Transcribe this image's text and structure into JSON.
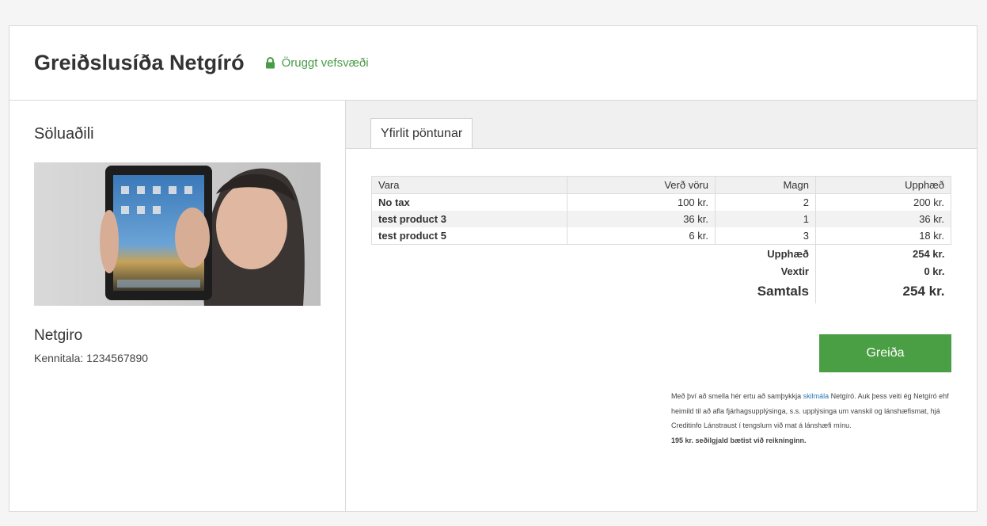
{
  "header": {
    "title": "Greiðslusíða Netgíró",
    "secure_label": "Öruggt vefsvæði",
    "accent_color": "#4a9b47"
  },
  "merchant": {
    "heading": "Söluaðili",
    "image_icon": "merchant-tablet-photo",
    "name": "Netgiro",
    "id_line": "Kennitala: 1234567890"
  },
  "order": {
    "tab_label": "Yfirlit pöntunar",
    "columns": [
      "Vara",
      "Verð vöru",
      "Magn",
      "Upphæð"
    ],
    "rows": [
      {
        "name": "No tax",
        "price": "100 kr.",
        "qty": "2",
        "amount": "200 kr."
      },
      {
        "name": "test product 3",
        "price": "36 kr.",
        "qty": "1",
        "amount": "36 kr."
      },
      {
        "name": "test product 5",
        "price": "6 kr.",
        "qty": "3",
        "amount": "18 kr."
      }
    ],
    "summary": {
      "subtotal_label": "Upphæð",
      "subtotal_value": "254 kr.",
      "interest_label": "Vextir",
      "interest_value": "0 kr.",
      "total_label": "Samtals",
      "total_value": "254 kr."
    }
  },
  "payment": {
    "button_label": "Greiða",
    "button_color": "#4a9f45",
    "terms_before": "Með því að smella hér ertu að samþykkja ",
    "terms_link": "skilmála",
    "terms_after": " Netgíró. Auk þess veiti ég Netgíró ehf heimild til að afla fjárhagsupplýsinga, s.s. upplýsinga um vanskil og lánshæfismat, hjá Creditinfo Lánstraust í tengslum við mat á lánshæfi mínu.",
    "fee_note": "195 kr. seðilgjald bætist við reikninginn."
  }
}
